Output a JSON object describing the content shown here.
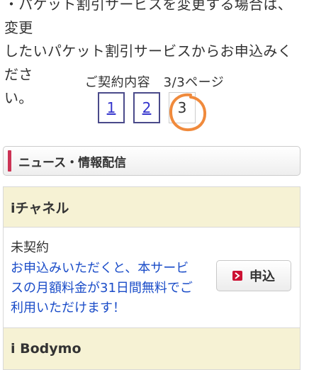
{
  "intro": {
    "line1": "・パケット割引サービスを変更する場合は、変更",
    "line2": "したいパケット割引サービスからお申込みくださ",
    "line3": "い。"
  },
  "pager": {
    "label": "ご契約内容　3/3ページ",
    "pages": [
      "1",
      "2",
      "3"
    ]
  },
  "section": {
    "title": "ニュース・情報配信"
  },
  "services": [
    {
      "name": "iチャネル",
      "status": "未契約",
      "description": "お申込みいただくと、本サービスの月額料金が31日間無料でご利用いただけます！",
      "apply_label": "申込"
    },
    {
      "name": "i Bodymo"
    }
  ],
  "colors": {
    "accent_bar": "#cc3355",
    "link": "#1a4cc8",
    "card_header_bg": "#f6f2d4",
    "annotation_circle": "#f08a3c"
  }
}
